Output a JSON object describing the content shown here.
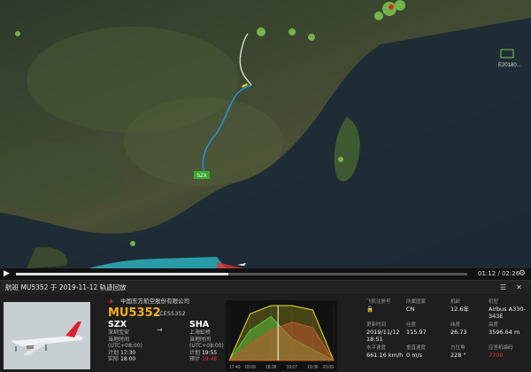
{
  "map": {
    "origin_label": "SZX",
    "squawk_badge": "E20180...",
    "colors": {
      "route": "#2a8fd8",
      "weather": "#7ec850",
      "origin_marker": "#36a82c"
    }
  },
  "timeline": {
    "progress": 0.47,
    "time_text": "01:12 / 02:26"
  },
  "titlebar": {
    "text": "航班 MU5352 于 2019-11-12 轨迹回放"
  },
  "flight": {
    "airline_name": "中国东方航空股份有限公司",
    "number": "MU5352",
    "codeshare": "/ CES5352",
    "origin": {
      "code": "SZX",
      "name": "深圳宝安",
      "tz_label": "当地时间",
      "tz": "(UTC+08:00)",
      "sched_label": "计划",
      "sched": "17:30",
      "actual_label": "实际",
      "actual": "18:00"
    },
    "dest": {
      "code": "SHA",
      "name": "上海虹桥",
      "tz_label": "当地时间",
      "tz": "(UTC+08:00)",
      "sched_label": "计划",
      "sched": "19:55",
      "est_label": "预计",
      "est": "19:46"
    }
  },
  "chart_data": {
    "type": "area",
    "x": [
      "17:40",
      "18:09",
      "18:38",
      "19:07",
      "19:36",
      "20:05"
    ],
    "series": [
      {
        "color": "#e8e020",
        "values": [
          0,
          85,
          100,
          100,
          92,
          0
        ]
      },
      {
        "color": "#5fbf3a",
        "values": [
          0,
          55,
          80,
          40,
          20,
          0
        ]
      },
      {
        "color": "#c05a30",
        "values": [
          0,
          30,
          55,
          70,
          60,
          0
        ]
      }
    ],
    "current_marker": "18:38",
    "ylim": [
      0,
      100
    ]
  },
  "details": [
    {
      "label": "飞机注册号",
      "value": "🔒",
      "red": false
    },
    {
      "label": "所属国家",
      "value": "CN",
      "red": false
    },
    {
      "label": "机龄",
      "value": "12.6年",
      "red": false
    },
    {
      "label": "机型",
      "value": "Airbus A330-343E",
      "red": false
    },
    {
      "label": "更新时间",
      "value": "2019/11/12 18:51",
      "red": false
    },
    {
      "label": "经度",
      "value": "115.97",
      "red": false
    },
    {
      "label": "纬度",
      "value": "26.73",
      "red": false
    },
    {
      "label": "高度",
      "value": "3596.64 m",
      "red": false
    },
    {
      "label": "水平速度",
      "value": "661.16 km/h",
      "red": false
    },
    {
      "label": "垂直速度",
      "value": "0 m/s",
      "red": false
    },
    {
      "label": "方位角",
      "value": "228 °",
      "red": false
    },
    {
      "label": "应答机编码",
      "value": "7700",
      "red": true
    }
  ]
}
